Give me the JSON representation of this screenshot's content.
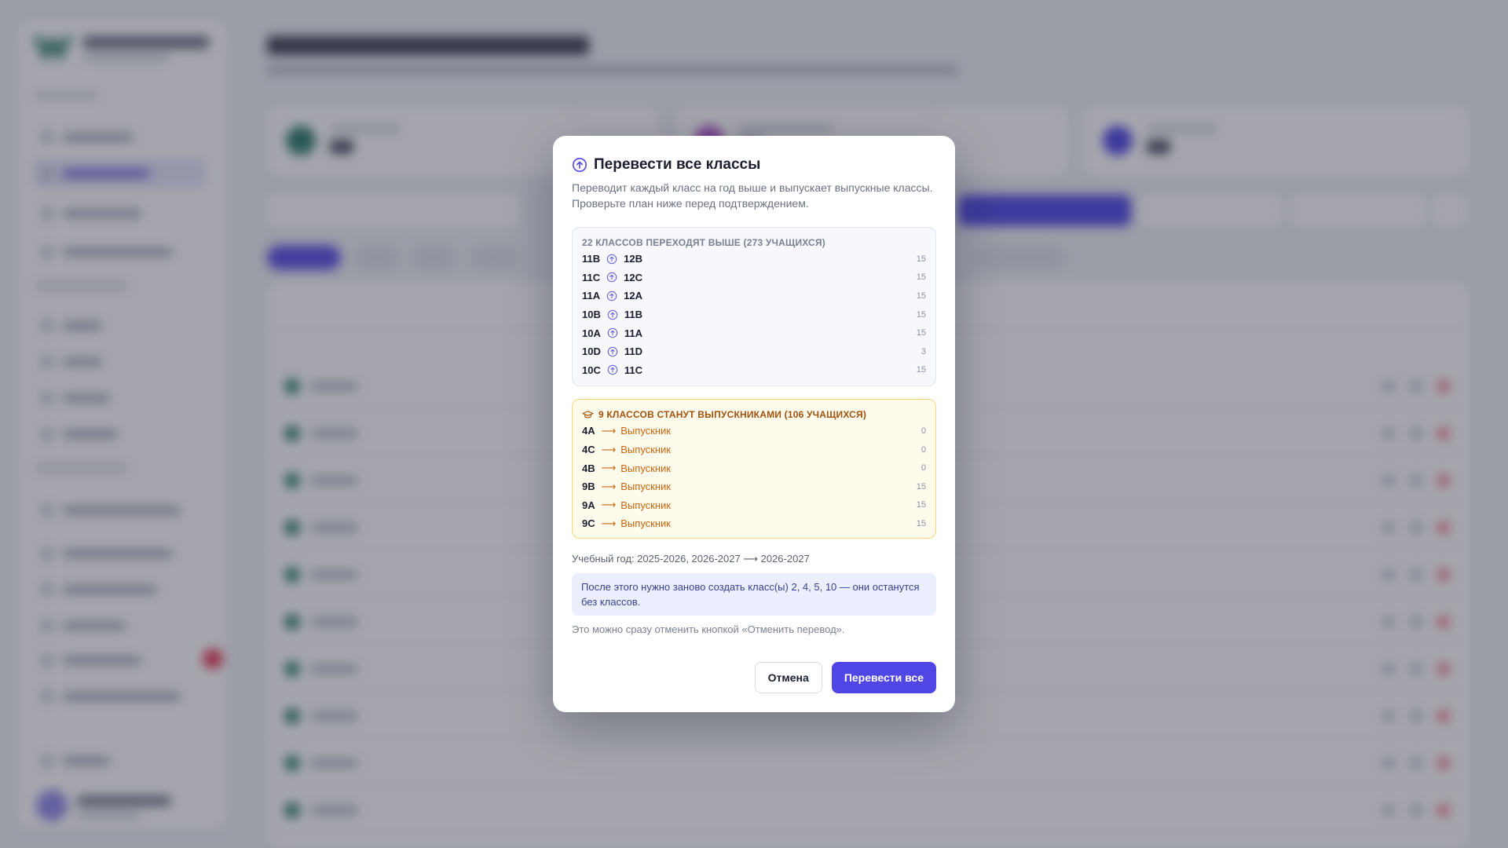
{
  "modal": {
    "title": "Перевести все классы",
    "description": "Переводит каждый класс на год выше и выпускает выпускные классы. Проверьте план ниже перед подтверждением.",
    "promote_heading": "22 КЛАССОВ ПЕРЕХОДЯТ ВЫШЕ (273 УЧАЩИХСЯ)",
    "promotions": [
      {
        "from": "11B",
        "to": "12B",
        "count": "15"
      },
      {
        "from": "11C",
        "to": "12C",
        "count": "15"
      },
      {
        "from": "11A",
        "to": "12A",
        "count": "15"
      },
      {
        "from": "10B",
        "to": "11B",
        "count": "15"
      },
      {
        "from": "10A",
        "to": "11A",
        "count": "15"
      },
      {
        "from": "10D",
        "to": "11D",
        "count": "3"
      },
      {
        "from": "10C",
        "to": "11C",
        "count": "15"
      }
    ],
    "graduate_heading": "9 КЛАССОВ СТАНУТ ВЫПУСКНИКАМИ (106 УЧАЩИХСЯ)",
    "graduates": [
      {
        "from": "4A",
        "arrow": "⟶",
        "to": "Выпускник",
        "count": "0"
      },
      {
        "from": "4C",
        "arrow": "⟶",
        "to": "Выпускник",
        "count": "0"
      },
      {
        "from": "4B",
        "arrow": "⟶",
        "to": "Выпускник",
        "count": "0"
      },
      {
        "from": "9B",
        "arrow": "⟶",
        "to": "Выпускник",
        "count": "15"
      },
      {
        "from": "9A",
        "arrow": "⟶",
        "to": "Выпускник",
        "count": "15"
      },
      {
        "from": "9C",
        "arrow": "⟶",
        "to": "Выпускник",
        "count": "15"
      }
    ],
    "academic_year": "Учебный год: 2025-2026, 2026-2027 ⟶ 2026-2027",
    "info_note": "После этого нужно заново создать класс(ы) 2, 4, 5, 10 — они останутся без классов.",
    "undo_note": "Это можно сразу отменить кнопкой «Отменить перевод».",
    "cancel_label": "Отмена",
    "confirm_label": "Перевести все"
  },
  "colors": {
    "primary": "#4f46e5",
    "graduate_text": "#c8660e",
    "graduate_bg": "#fffbec",
    "overlay": "rgba(40,44,60,0.42)"
  },
  "icons": {
    "title": "arrow-up-circle-icon",
    "promote_row": "arrow-up-circle-icon",
    "graduate_heading": "graduation-cap-icon"
  }
}
